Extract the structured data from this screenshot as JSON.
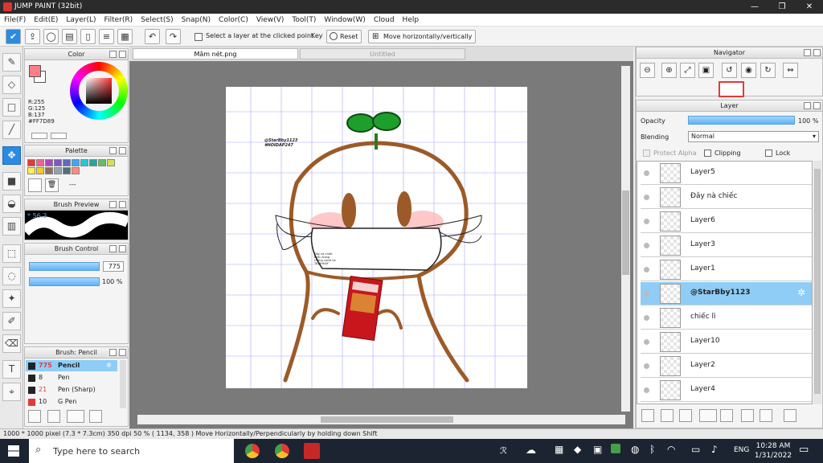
{
  "window": {
    "title": "JUMP PAINT (32bit)",
    "minimize": "—",
    "maximize": "❐",
    "close": "✕"
  },
  "menu": [
    "File(F)",
    "Edit(E)",
    "Layer(L)",
    "Filter(R)",
    "Select(S)",
    "Snap(N)",
    "Color(C)",
    "View(V)",
    "Tool(T)",
    "Window(W)",
    "Cloud",
    "Help"
  ],
  "toolbar": {
    "select_layer_label": "Select a layer at the clicked point",
    "key_label": "Key",
    "reset_label": "Reset",
    "move_label": "Move horizontally/vertically"
  },
  "color_panel": {
    "title": "Color",
    "r": "R:255",
    "g": "G:125",
    "b": "B:137",
    "hex": "#FF7D89",
    "main_color": "#ff7d89"
  },
  "palette_panel": {
    "title": "Palette",
    "extra": "---",
    "swatches": [
      "#e53935",
      "#f06292",
      "#ab47bc",
      "#7e57c2",
      "#5c6bc0",
      "#42a5f5",
      "#26c6da",
      "#26a69a",
      "#66bb6a",
      "#d4e157",
      "#ffee58",
      "#ffca28",
      "#8d6e63",
      "#90a4ae",
      "#546e7a",
      "#ff8a80"
    ]
  },
  "brush_preview": {
    "title": "Brush Preview",
    "size": "* 56.3"
  },
  "brush_control": {
    "title": "Brush Control",
    "size_value": "775",
    "opacity_value": "100 %"
  },
  "brush_list": {
    "title": "Brush: Pencil",
    "items": [
      {
        "size": "775",
        "name": "Pencil",
        "color": "#e53935"
      },
      {
        "size": "8",
        "name": "Pen",
        "color": "#222"
      },
      {
        "size": "21",
        "name": "Pen (Sharp)",
        "color": "#e53935"
      },
      {
        "size": "10",
        "name": "G Pen",
        "color": "#222"
      }
    ]
  },
  "tabs": {
    "active": "Mâm nét.png",
    "inactive": "Untitled"
  },
  "artwork": {
    "watermark_line1": "@StarBby1123",
    "watermark_line2": "#HOIDAP247",
    "mask_text": "Đây nà chiếc khẩu trang chống covid ủa TRINHHAY"
  },
  "navigator": {
    "title": "Navigator"
  },
  "layer_panel": {
    "title": "Layer",
    "opacity_label": "Opacity",
    "opacity_value": "100 %",
    "blending_label": "Blending",
    "blending_value": "Normal",
    "protect_alpha": "Protect Alpha",
    "clipping": "Clipping",
    "lock": "Lock",
    "layers": [
      "Layer5",
      "Đây nà chiếc",
      "Layer6",
      "Layer3",
      "Layer1",
      "@StarBby1123",
      "chiếc lì",
      "Layer10",
      "Layer2",
      "Layer4"
    ],
    "selected_index": 5
  },
  "status": {
    "text": "1000 * 1000 pixel   (7.3 * 7.3cm)   350 dpi   50 %   ( 1134, 358 )   Move Horizontally/Perpendicularly by holding down Shift"
  },
  "taskbar": {
    "search_placeholder": "Type here to search",
    "lang": "ENG",
    "time": "10:28 AM",
    "date": "1/31/2022"
  }
}
